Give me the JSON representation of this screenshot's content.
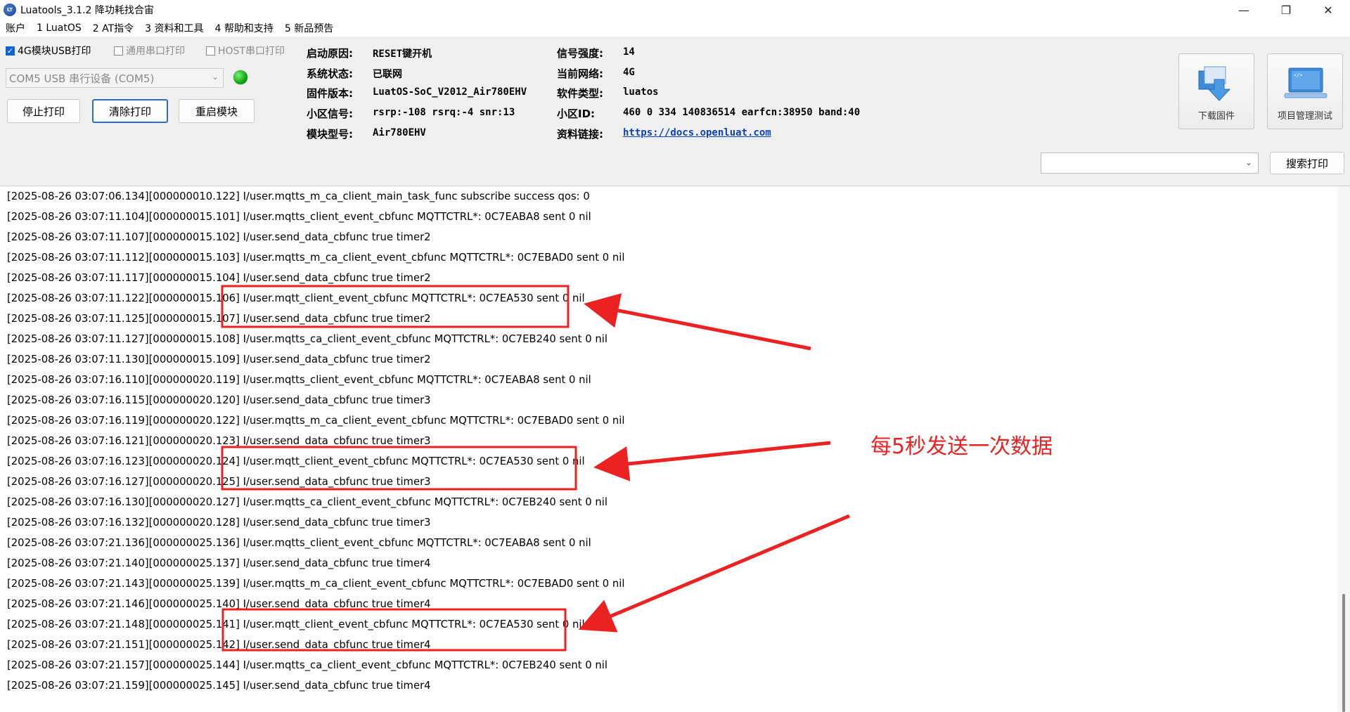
{
  "window": {
    "title": "Luatools_3.1.2 降功耗找合宙",
    "minimize_glyph": "—",
    "maximize_glyph": "❐",
    "close_glyph": "✕"
  },
  "menu": [
    "账户",
    "1 LuatOS",
    "2 AT指令",
    "3 资料和工具",
    "4 帮助和支持",
    "5 新品预告"
  ],
  "options": {
    "usb_print": {
      "label": "4G模块USB打印",
      "checked": true
    },
    "serial_print": {
      "label": "通用串口打印",
      "checked": false
    },
    "host_print": {
      "label": "HOST串口打印",
      "checked": false
    }
  },
  "port": {
    "selected": "COM5 USB 串行设备 (COM5)"
  },
  "buttons": {
    "stop": "停止打印",
    "clear": "清除打印",
    "restart": "重启模块",
    "download": "下载固件",
    "project": "项目管理测试",
    "search": "搜索打印"
  },
  "info": {
    "boot_reason_label": "启动原因:",
    "boot_reason": "RESET键开机",
    "sys_state_label": "系统状态:",
    "sys_state": "已联网",
    "firmware_label": "固件版本:",
    "firmware": "LuatOS-SoC_V2012_Air780EHV",
    "cell_signal_label": "小区信号:",
    "cell_signal": "rsrp:-108 rsrq:-4 snr:13",
    "model_label": "模块型号:",
    "model": "Air780EHV",
    "signal_label": "信号强度:",
    "signal": "14",
    "network_label": "当前网络:",
    "network": "4G",
    "software_label": "软件类型:",
    "software": "luatos",
    "cell_id_label": "小区ID:",
    "cell_id": "460 0 334 140836514 earfcn:38950 band:40",
    "docs_label": "资料链接:",
    "docs": "https://docs.openluat.com"
  },
  "search": {
    "value": ""
  },
  "log": [
    "[2025-08-26 03:07:06.134][000000010.122] I/user.mqtts_m_ca_client_main_task_func subscribe success qos: 0",
    "[2025-08-26 03:07:11.104][000000015.101] I/user.mqtts_client_event_cbfunc MQTTCTRL*: 0C7EABA8 sent 0 nil",
    "[2025-08-26 03:07:11.107][000000015.102] I/user.send_data_cbfunc true timer2",
    "[2025-08-26 03:07:11.112][000000015.103] I/user.mqtts_m_ca_client_event_cbfunc MQTTCTRL*: 0C7EBAD0 sent 0 nil",
    "[2025-08-26 03:07:11.117][000000015.104] I/user.send_data_cbfunc true timer2",
    "[2025-08-26 03:07:11.122][000000015.106] I/user.mqtt_client_event_cbfunc MQTTCTRL*: 0C7EA530 sent 0 nil",
    "[2025-08-26 03:07:11.125][000000015.107] I/user.send_data_cbfunc true timer2",
    "[2025-08-26 03:07:11.127][000000015.108] I/user.mqtts_ca_client_event_cbfunc MQTTCTRL*: 0C7EB240 sent 0 nil",
    "[2025-08-26 03:07:11.130][000000015.109] I/user.send_data_cbfunc true timer2",
    "[2025-08-26 03:07:16.110][000000020.119] I/user.mqtts_client_event_cbfunc MQTTCTRL*: 0C7EABA8 sent 0 nil",
    "[2025-08-26 03:07:16.115][000000020.120] I/user.send_data_cbfunc true timer3",
    "[2025-08-26 03:07:16.119][000000020.122] I/user.mqtts_m_ca_client_event_cbfunc MQTTCTRL*: 0C7EBAD0 sent 0 nil",
    "[2025-08-26 03:07:16.121][000000020.123] I/user.send_data_cbfunc true timer3",
    "[2025-08-26 03:07:16.123][000000020.124] I/user.mqtt_client_event_cbfunc MQTTCTRL*: 0C7EA530 sent 0 nil",
    "[2025-08-26 03:07:16.127][000000020.125] I/user.send_data_cbfunc true timer3",
    "[2025-08-26 03:07:16.130][000000020.127] I/user.mqtts_ca_client_event_cbfunc MQTTCTRL*: 0C7EB240 sent 0 nil",
    "[2025-08-26 03:07:16.132][000000020.128] I/user.send_data_cbfunc true timer3",
    "[2025-08-26 03:07:21.136][000000025.136] I/user.mqtts_client_event_cbfunc MQTTCTRL*: 0C7EABA8 sent 0 nil",
    "[2025-08-26 03:07:21.140][000000025.137] I/user.send_data_cbfunc true timer4",
    "[2025-08-26 03:07:21.143][000000025.139] I/user.mqtts_m_ca_client_event_cbfunc MQTTCTRL*: 0C7EBAD0 sent 0 nil",
    "[2025-08-26 03:07:21.146][000000025.140] I/user.send_data_cbfunc true timer4",
    "[2025-08-26 03:07:21.148][000000025.141] I/user.mqtt_client_event_cbfunc MQTTCTRL*: 0C7EA530 sent 0 nil",
    "[2025-08-26 03:07:21.151][000000025.142] I/user.send_data_cbfunc true timer4",
    "[2025-08-26 03:07:21.157][000000025.144] I/user.mqtts_ca_client_event_cbfunc MQTTCTRL*: 0C7EB240 sent 0 nil",
    "[2025-08-26 03:07:21.159][000000025.145] I/user.send_data_cbfunc true timer4"
  ],
  "annotation": {
    "text": "每5秒发送一次数据",
    "color": "#ec2222"
  },
  "colors": {
    "accent": "#0a64d6",
    "status_ok": "#0fa80f",
    "link": "#0b3fc4"
  }
}
